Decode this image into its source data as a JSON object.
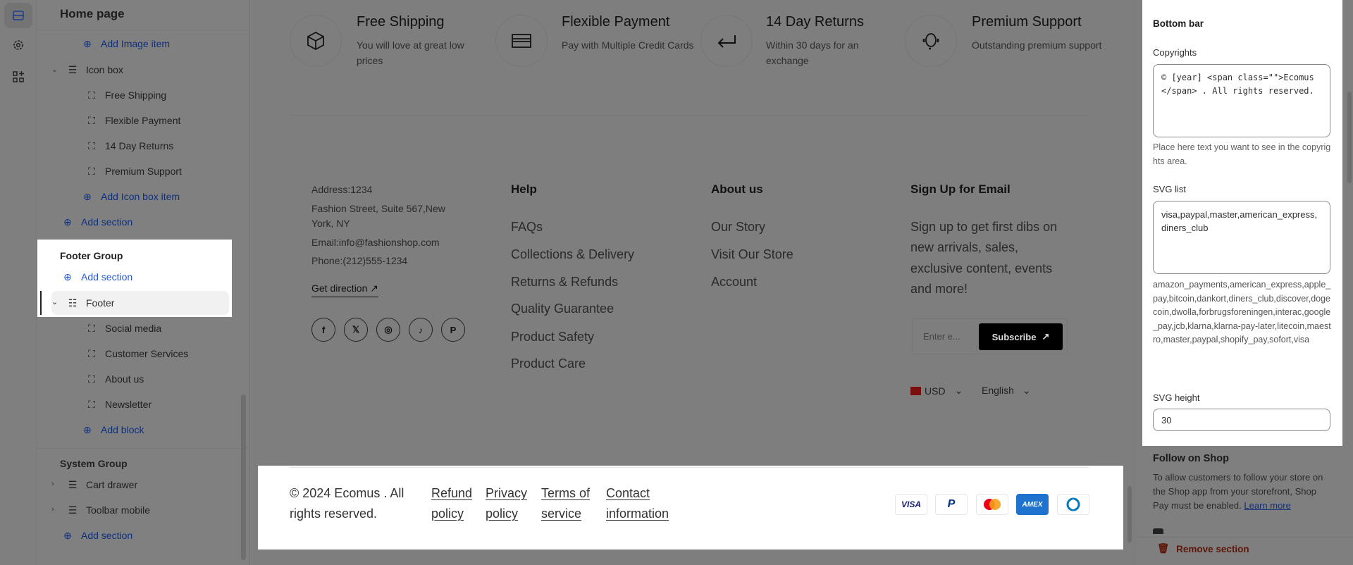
{
  "rail": {
    "icons": [
      "sections-icon",
      "settings-gear-icon",
      "apps-add-icon"
    ]
  },
  "sidebar": {
    "title": "Home page",
    "items": [
      {
        "label": "Add Image item",
        "type": "add"
      },
      {
        "label": "Icon box",
        "type": "section"
      },
      {
        "label": "Free Shipping",
        "type": "block"
      },
      {
        "label": "Flexible Payment",
        "type": "block"
      },
      {
        "label": "14 Day Returns",
        "type": "block"
      },
      {
        "label": "Premium Support",
        "type": "block"
      },
      {
        "label": "Add Icon box item",
        "type": "add"
      },
      {
        "label": "Add section",
        "type": "add"
      }
    ],
    "footer_group": {
      "title": "Footer Group",
      "add_section": "Add section",
      "footer": "Footer",
      "blocks": [
        "Social media",
        "Customer Services",
        "About us",
        "Newsletter"
      ],
      "add_block": "Add block"
    },
    "system_group": {
      "title": "System Group",
      "items": [
        "Cart drawer",
        "Toolbar mobile"
      ],
      "add_section": "Add section"
    }
  },
  "preview": {
    "icon_boxes": [
      {
        "title": "Free Shipping",
        "desc": "You will love at great low prices",
        "icon": "box-icon"
      },
      {
        "title": "Flexible Payment",
        "desc": "Pay with Multiple Credit Cards",
        "icon": "credit-card-icon"
      },
      {
        "title": "14 Day Returns",
        "desc": "Within 30 days for an exchange",
        "icon": "return-arrow-icon"
      },
      {
        "title": "Premium Support",
        "desc": "Outstanding premium support",
        "icon": "headset-icon"
      }
    ],
    "contact": {
      "lines": [
        "Address:1234",
        "Fashion Street, Suite 567,New",
        "York, NY",
        "Email:info@fashionshop.com",
        "Phone:(212)555-1234"
      ],
      "direction": "Get direction"
    },
    "socials": [
      "facebook",
      "x",
      "instagram",
      "tiktok",
      "pinterest"
    ],
    "help": {
      "title": "Help",
      "links": [
        "FAQs",
        "Collections & Delivery",
        "Returns & Refunds",
        "Quality Guarantee",
        "Product Safety",
        "Product Care"
      ]
    },
    "about": {
      "title": "About us",
      "links": [
        "Our Story",
        "Visit Our Store",
        "Account"
      ]
    },
    "signup": {
      "title": "Sign Up for Email",
      "lines": [
        "Sign up to get first dibs on",
        "new arrivals, sales,",
        "exclusive content, events",
        "and more!"
      ],
      "placeholder": "Enter e...",
      "button": "Subscribe"
    },
    "currency": "USD",
    "language": "English",
    "bottom": {
      "copyright": [
        "© 2024 Ecomus . All",
        "rights reserved."
      ],
      "links": [
        [
          "Refund",
          "policy"
        ],
        [
          "Privacy",
          "policy"
        ],
        [
          "Terms of",
          "service"
        ],
        [
          "Contact",
          "information"
        ]
      ],
      "payments": [
        "VISA",
        "PayPal",
        "Mastercard",
        "AMEX",
        "Diners Club"
      ]
    }
  },
  "settings": {
    "title": "Bottom bar",
    "copyrights_label": "Copyrights",
    "copyrights_value": "© [year] <span class=\"\">Ecomus</span> . All rights reserved.",
    "copyrights_help": "Place here text you want to see in the copyrights area.",
    "svg_list_label": "SVG list",
    "svg_list_value": "visa,paypal,master,american_express,diners_club",
    "svg_list_help": "amazon_payments,american_express,apple_pay,bitcoin,dankort,diners_club,discover,dogecoin,dwolla,forbrugsforeningen,interac,google_pay,jcb,klarna,klarna-pay-later,litecoin,maestro,master,paypal,shopify_pay,sofort,visa",
    "svg_height_label": "SVG height",
    "svg_height_value": "30",
    "follow_title": "Follow on Shop",
    "follow_text": "To allow customers to follow your store on the Shop app from your storefront, Shop Pay must be enabled.",
    "learn_more": "Learn more",
    "remove": "Remove section"
  },
  "colors": {
    "accent": "#2458d6",
    "remove": "#8e1f0b",
    "amex": "#1f72cd"
  }
}
